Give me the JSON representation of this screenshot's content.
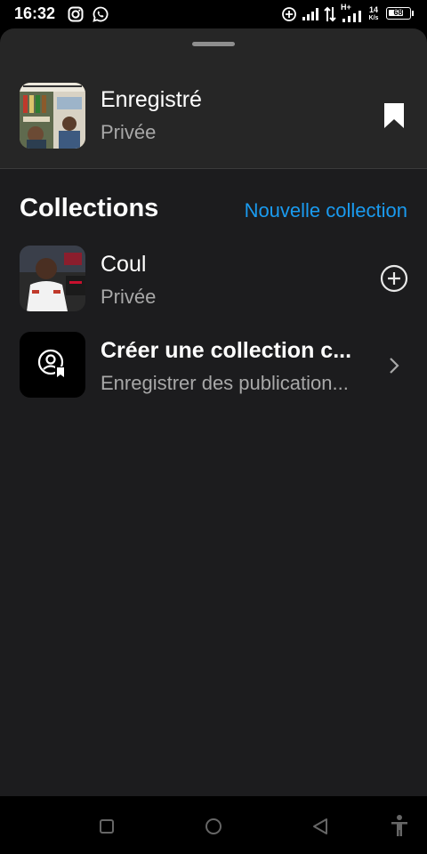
{
  "status_bar": {
    "time": "16:32",
    "network_speed_value": "14",
    "network_speed_unit": "K/s",
    "network_type": "H+",
    "battery_level": "68"
  },
  "saved": {
    "title": "Enregistré",
    "privacy": "Privée",
    "thumbnail_icon": "saved-posts-thumbnail",
    "bookmark_icon": "bookmark-icon"
  },
  "collections": {
    "heading": "Collections",
    "new_collection_label": "Nouvelle collection",
    "items": [
      {
        "name": "Coul",
        "subtitle": "Privée",
        "action_icon": "add-circle-icon"
      },
      {
        "name": "Créer une collection c...",
        "subtitle": "Enregistrer des publication...",
        "action_icon": "chevron-right-icon"
      }
    ]
  },
  "nav_bar": {
    "buttons": [
      "recents-button",
      "home-button",
      "back-button",
      "accessibility-button"
    ]
  },
  "colors": {
    "accent": "#1a9bf0",
    "sheet_bg": "#262626",
    "list_bg": "#1c1c1e",
    "secondary_text": "#a8a8a8"
  }
}
